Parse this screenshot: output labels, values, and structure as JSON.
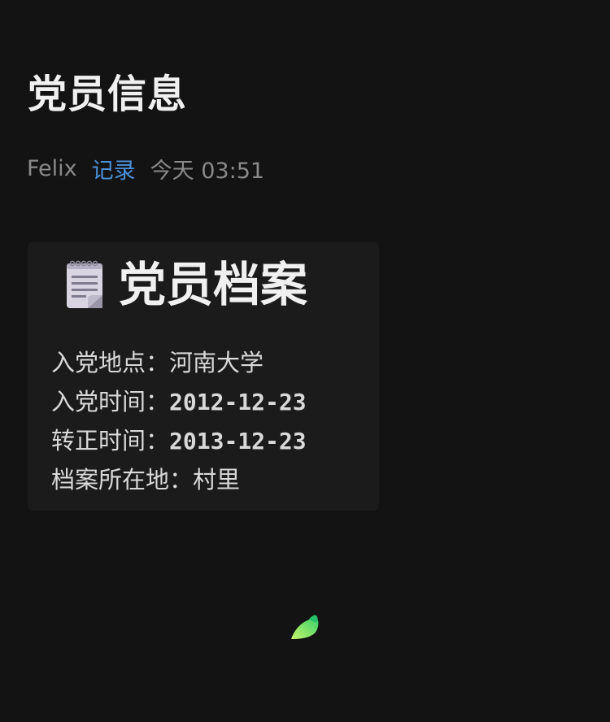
{
  "post": {
    "title": "党员信息",
    "author": "Felix",
    "category": "记录",
    "time": "今天 03:51"
  },
  "card": {
    "icon": "notepad-icon",
    "title": "党员档案",
    "rows": [
      {
        "label": "入党地点：",
        "value": "河南大学"
      },
      {
        "label": "入党时间：",
        "value": "2012-12-23"
      },
      {
        "label": "转正时间：",
        "value": "2013-12-23"
      },
      {
        "label": "档案所在地：",
        "value": "村里"
      }
    ]
  },
  "footer": {
    "logo": "leaf-logo-icon"
  },
  "colors": {
    "background": "#131313",
    "card_background": "#1b1b1b",
    "accent": "#4a90d9",
    "muted": "#8a8a8a"
  }
}
